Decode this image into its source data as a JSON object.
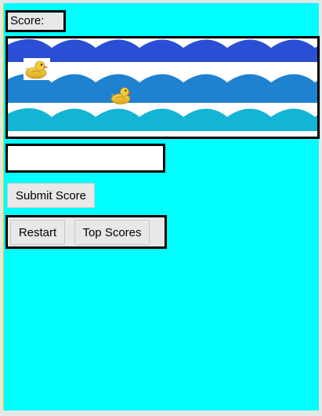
{
  "score": {
    "label": "Score:",
    "value": ""
  },
  "game": {
    "wave_colors": [
      "#2a4fd4",
      "#1e82d0",
      "#13b4d4"
    ],
    "background": "#00ffff",
    "ducks": [
      {
        "name": "duck-1",
        "icon": "rubber-duck-icon"
      },
      {
        "name": "duck-2",
        "icon": "rubber-duck-icon"
      }
    ]
  },
  "form": {
    "input_value": "",
    "input_placeholder": "",
    "submit_label": "Submit Score"
  },
  "controls": {
    "restart_label": "Restart",
    "top_scores_label": "Top Scores"
  }
}
